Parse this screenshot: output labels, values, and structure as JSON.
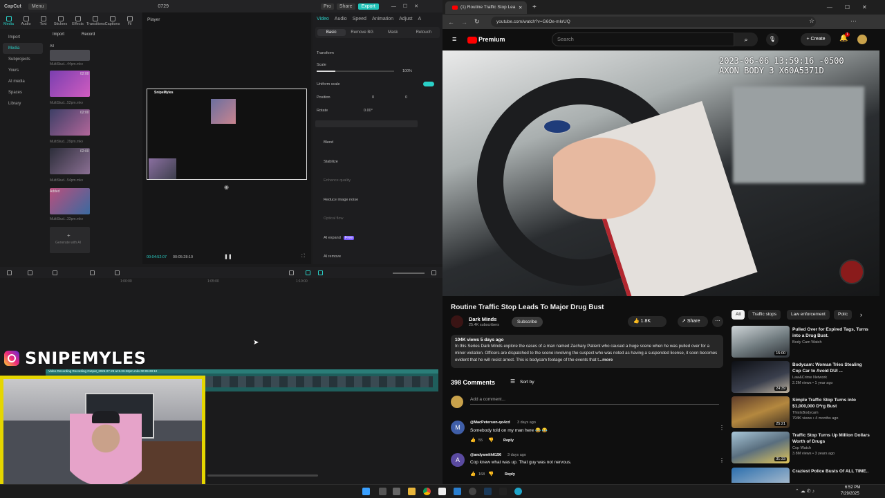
{
  "capcut": {
    "logo": "CapCut",
    "menu": "Menu",
    "project_title": "0729",
    "pro_label": "Pro",
    "share_label": "Share",
    "export_label": "Export",
    "tools": [
      "Media",
      "Audio",
      "Text",
      "Stickers",
      "Effects",
      "Transitions",
      "Captions",
      "Fil"
    ],
    "sidebar": [
      "Import",
      "Media",
      "Subprojects",
      "Yours",
      "AI media",
      "Spaces",
      "Library"
    ],
    "import_button": "Import",
    "record_button": "Record",
    "media_filter": "All",
    "media_items": [
      {
        "dur": "",
        "name": "MultiStud...44pm.mkv"
      },
      {
        "dur": "02:00",
        "name": "MultiStud...52pm.mkv"
      },
      {
        "dur": "02:00",
        "name": "MultiStud...29pm.mkv"
      },
      {
        "dur": "02:00",
        "name": "MultiStud...54pm.mkv"
      },
      {
        "dur": "Added",
        "name": "MultiStud...33pm.mkv"
      }
    ],
    "generate_label": "Generate with AI",
    "player_label": "Player",
    "time_current": "00:04:52:07",
    "time_total": "00:05:28:10",
    "inspector_tabs": [
      "Video",
      "Audio",
      "Speed",
      "Animation",
      "Adjust",
      "A"
    ],
    "inspector_subtabs": [
      "Basic",
      "Remove BG",
      "Mask",
      "Retouch"
    ],
    "transform": "Transform",
    "scale_label": "Scale",
    "scale_value": "100%",
    "uniform_scale": "Uniform scale",
    "position_label": "Position",
    "pos_x": "0",
    "pos_y": "0",
    "rotate_label": "Rotate",
    "rotate_value": "0.00°",
    "blend": "Blend",
    "stabilize": "Stabilize",
    "enhance_quality": "Enhance quality",
    "reduce_noise": "Reduce image noise",
    "optical_flow": "Optical flow",
    "ai_expand": "AI expand",
    "ai_expand_badge": "Free",
    "ai_remove": "AI remove",
    "ruler": [
      "1:00:00",
      "1:05:00",
      "1:10:00"
    ],
    "clip_label": "Video Recording Recording Output_2025-07-29 at 5.33.32pm.mkv 00:05:28:10",
    "mini_brand": "SnipeMyles"
  },
  "overlay": {
    "brand_name": "SNIPEMYLES",
    "accent": "#e5d600"
  },
  "browser": {
    "tab_title": "(1) Routine Traffic Stop Lea",
    "url": "youtube.com/watch?v=G6Oe-mkrUQ"
  },
  "youtube": {
    "logo": "Premium",
    "search_placeholder": "Search",
    "create_label": "Create",
    "notif_count": "1",
    "video_overlay_line1": "2023-06-06 13:59:16 -0500",
    "video_overlay_line2": "AXON BODY 3 X60A5371D",
    "title": "Routine Traffic Stop Leads To Major Drug Bust",
    "channel": "Dark Minds",
    "subs": "25.4K subscribers",
    "subscribe": "Subscribe",
    "likes": "1.8K",
    "share": "Share",
    "desc_meta": "104K views  5 days ago",
    "desc_text": "In this Series Dark Minds explore the cases of a man named Zachary Patient who caused a huge scene when he was pulled over for a minor violation.  Officers are dispatched to the scene involving the suspect who was noted as having a suspended license, it soon becomes evident that he will resist arrest.   This is bodycam footage of the events that t",
    "more": "...more",
    "comments_count": "398 Comments",
    "sort_by": "Sort by",
    "add_comment": "Add a comment...",
    "comments": [
      {
        "initial": "M",
        "color": "#3f5ea8",
        "author": "@MacPeterson-qo4cd",
        "time": "3 days ago",
        "text": "Somebody told on my man here 😂 😂",
        "likes": "55",
        "reply": "Reply"
      },
      {
        "initial": "A",
        "color": "#5a4aa0",
        "author": "@andysmith6156",
        "time": "3 days ago",
        "text": "Cop knew what was up. That guy was not nervous.",
        "likes": "168",
        "reply": "Reply"
      }
    ],
    "chips": [
      "All",
      "Traffic stops",
      "Law enforcement",
      "Polic"
    ],
    "recs": [
      {
        "title": "Pulled Over for Expired Tags, Turns into a Drug Bust.",
        "channel": "Body Cam Watch",
        "meta": "",
        "dur": "15:00"
      },
      {
        "title": "Bodycam: Woman Tries Stealing Cop Car to Avoid DUI ...",
        "channel": "Law&Crime Network",
        "meta": "2.2M views • 1 year ago",
        "dur": "24:39"
      },
      {
        "title": "Simple Traffic Stop Turns into $1,000,000 D*rg Bust",
        "channel": "ThisIsBodycam",
        "meta": "794K views • 4 months ago",
        "dur": "25:21"
      },
      {
        "title": "Traffic Stop Turns Up Million Dollars Worth of Drugs",
        "channel": "Cop Watch",
        "meta": "3.8M views • 3 years ago",
        "dur": "31:33"
      },
      {
        "title": "Craziest Police Busts Of ALL TIME..",
        "channel": "",
        "meta": "",
        "dur": ""
      }
    ]
  },
  "taskbar": {
    "time": "6:52 PM",
    "date": "7/29/2025"
  }
}
